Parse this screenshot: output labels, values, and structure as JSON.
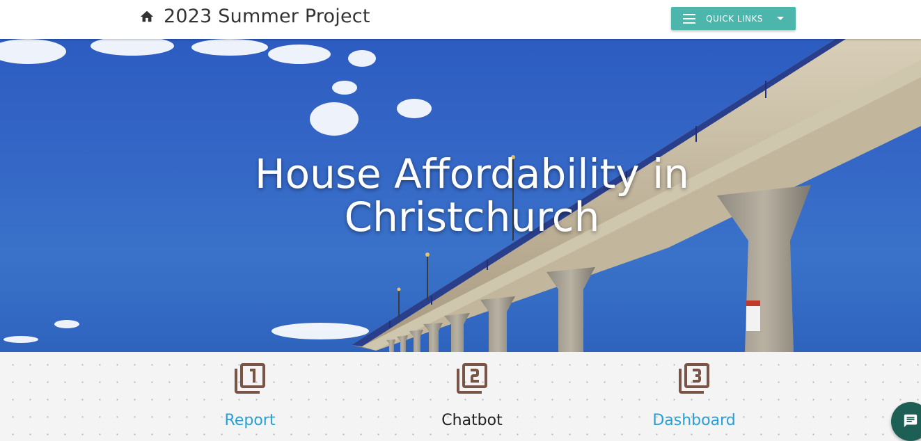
{
  "header": {
    "title": "2023 Summer Project",
    "quick_links_label": "QUICK LINKS"
  },
  "hero": {
    "title_line1": "House Affordability in",
    "title_line2": "Christchurch"
  },
  "cards": [
    {
      "label": "Report",
      "icon": "filter-1-icon"
    },
    {
      "label": "Chatbot",
      "icon": "filter-2-icon"
    },
    {
      "label": "Dashboard",
      "icon": "filter-3-icon"
    }
  ],
  "colors": {
    "accent": "#4db6ac",
    "link": "#2a9fd6",
    "icon_brown": "#795548",
    "fab": "#1e5f55"
  }
}
